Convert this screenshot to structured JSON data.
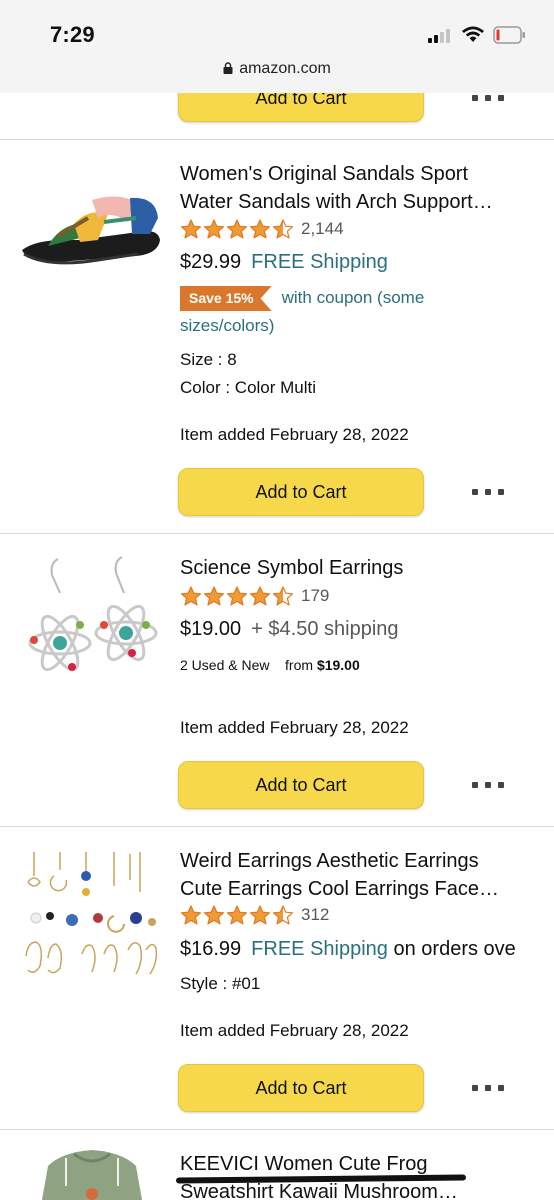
{
  "status": {
    "time": "7:29"
  },
  "browser": {
    "url": "amazon.com"
  },
  "colors": {
    "accent_link": "#2a6f7e",
    "button_yellow": "#f7d84a",
    "star": "#f09a36",
    "coupon": "#d9782d"
  },
  "top_partial": {
    "add_to_cart": "Add to Cart"
  },
  "items": [
    {
      "title_line1": "Women's Original Sandals Sport",
      "title_line2": "Water Sandals with Arch Support…",
      "rating_stars": 4.5,
      "rating_count": "2,144",
      "price": "$29.99",
      "shipping": "FREE Shipping",
      "coupon_badge": "Save 15%",
      "coupon_text_line1": "with coupon (some",
      "coupon_text_line2": "sizes/colors)",
      "size": "Size : 8",
      "color": "Color : Color Multi",
      "added": "Item added February 28, 2022",
      "add_to_cart": "Add to Cart"
    },
    {
      "title_line1": "Science Symbol Earrings",
      "rating_stars": 4.5,
      "rating_count": "179",
      "price": "$19.00",
      "shipping": "+ $4.50 shipping",
      "used_new": "2 Used & New",
      "from_label": "from",
      "from_price": "$19.00",
      "added": "Item added February 28, 2022",
      "add_to_cart": "Add to Cart"
    },
    {
      "title_line1": "Weird Earrings Aesthetic Earrings",
      "title_line2": "Cute Earrings Cool Earrings Face…",
      "rating_stars": 4.5,
      "rating_count": "312",
      "price": "$16.99",
      "shipping": "FREE Shipping",
      "shipping_suffix": "on orders ove",
      "style": "Style : #01",
      "added": "Item added February 28, 2022",
      "add_to_cart": "Add to Cart"
    },
    {
      "title_line1": "KEEVICI Women Cute Frog",
      "title_line2": "Sweatshirt Kawaii Mushroom…"
    }
  ]
}
